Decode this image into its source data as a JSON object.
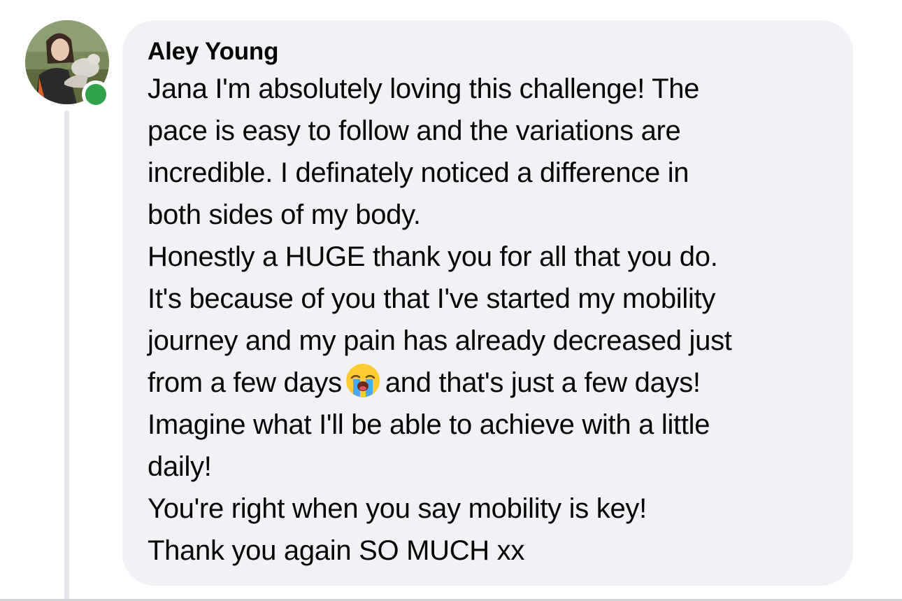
{
  "comment": {
    "author": "Aley Young",
    "avatar_icon": "profile-photo",
    "status_icon": "online-status-dot",
    "status_color": "#31a24c",
    "lines": [
      "Jana I'm absolutely loving this challenge! The",
      "pace is easy to follow and the variations are",
      "incredible. I definately noticed a difference in",
      "both sides of my body.",
      "Honestly a HUGE thank you for all that you do.",
      "It's because of you that I've started my mobility",
      "journey and my pain has already decreased just",
      "from a few days",
      "and that's just a few days!",
      "Imagine what I'll be able to achieve with a little",
      "daily!",
      "You're right when you say mobility is key!",
      "Thank you again SO MUCH xx"
    ],
    "emoji_icon": "loudly-crying-face-emoji"
  }
}
